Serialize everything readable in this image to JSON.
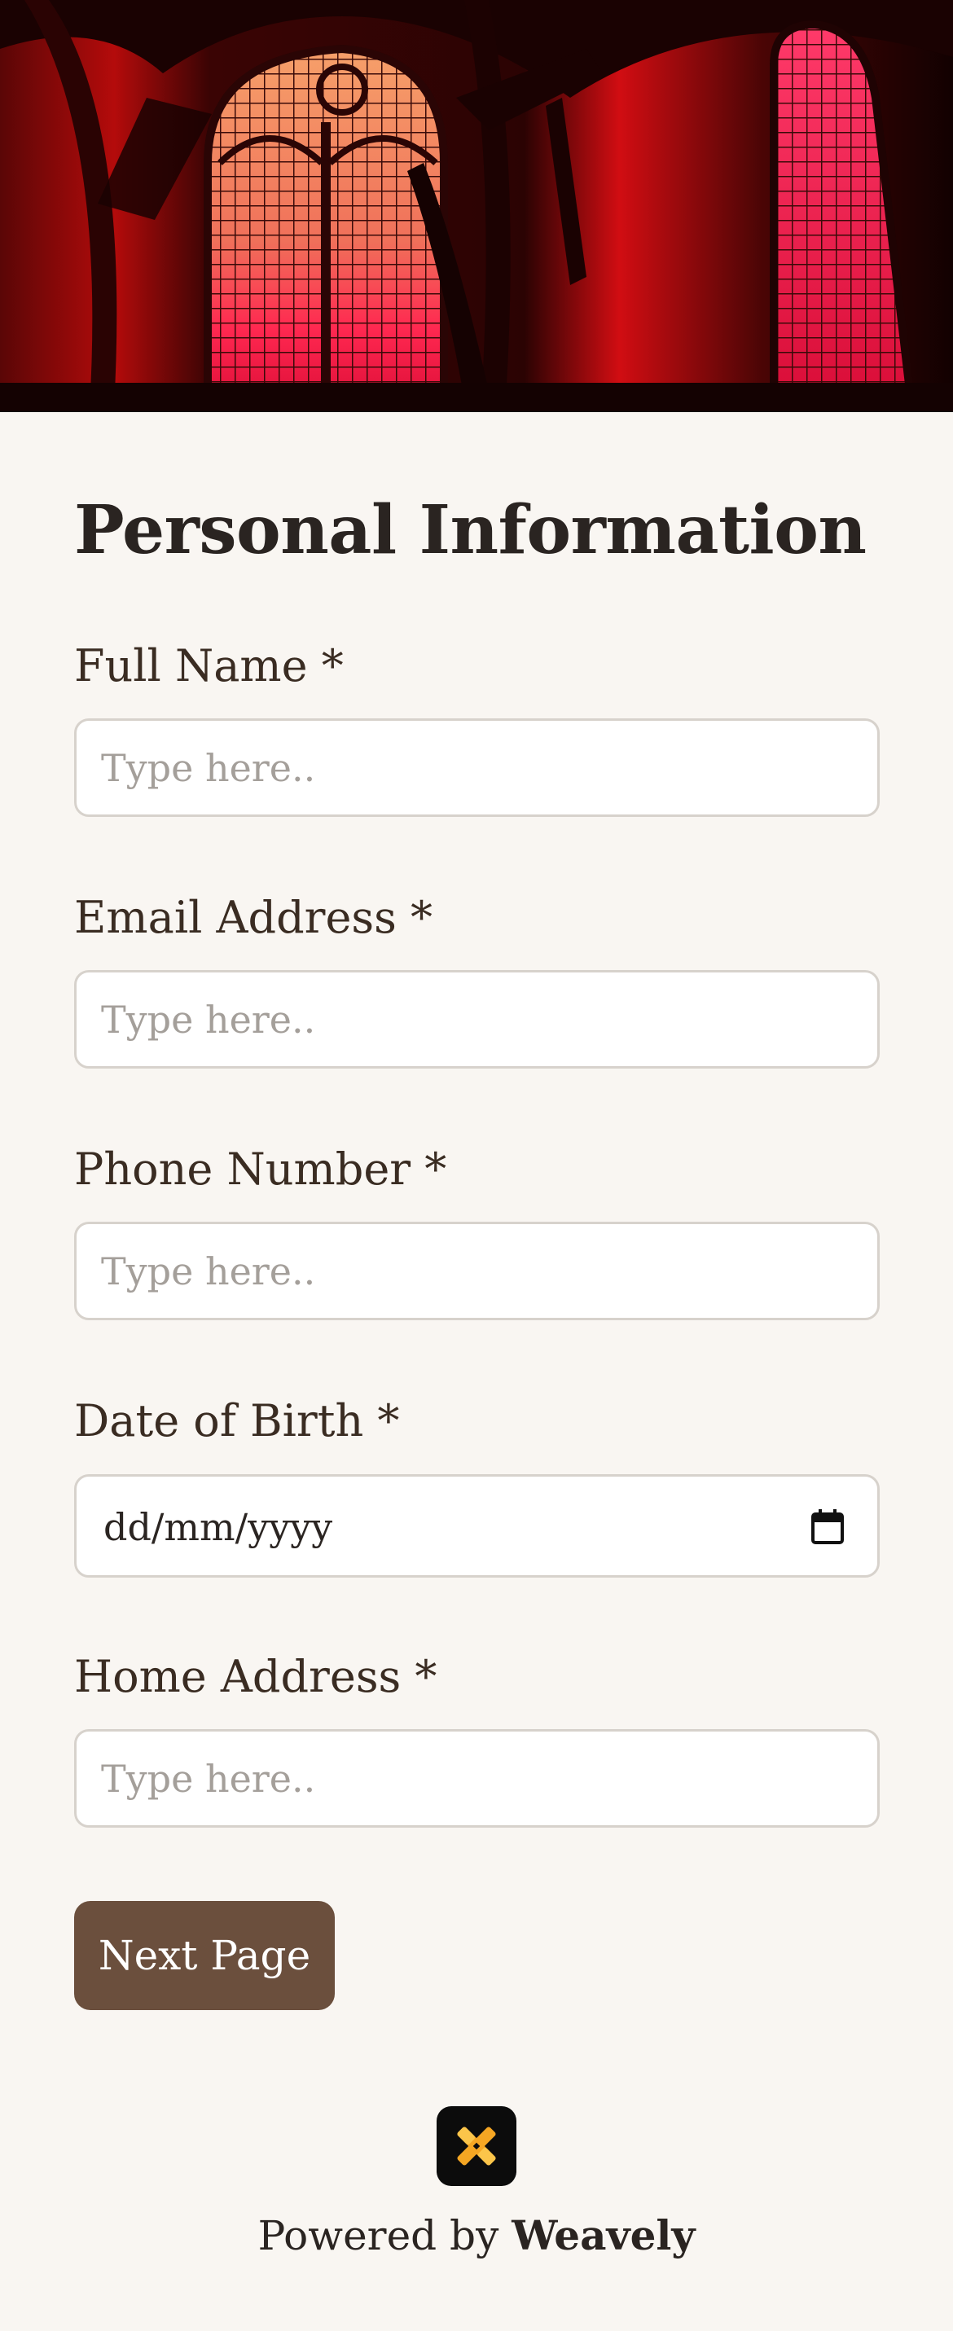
{
  "form": {
    "title": "Personal Information",
    "fields": [
      {
        "label": "Full Name *",
        "placeholder": "Type here..",
        "type": "text"
      },
      {
        "label": "Email Address *",
        "placeholder": "Type here..",
        "type": "email"
      },
      {
        "label": "Phone Number *",
        "placeholder": "Type here..",
        "type": "tel"
      },
      {
        "label": "Date of Birth *",
        "value": "dd/mm/yyyy",
        "type": "date"
      },
      {
        "label": "Home Address *",
        "placeholder": "Type here..",
        "type": "text"
      }
    ],
    "next_button_label": "Next Page"
  },
  "footer": {
    "powered_prefix": "Powered by",
    "brand": "Weavely",
    "logo_icon": "weavely-logo-icon"
  },
  "colors": {
    "page_background": "#f9f6f2",
    "button": "#6b4f3d",
    "input_border": "#d7d2cc",
    "hero_accent": "#e0103a"
  }
}
